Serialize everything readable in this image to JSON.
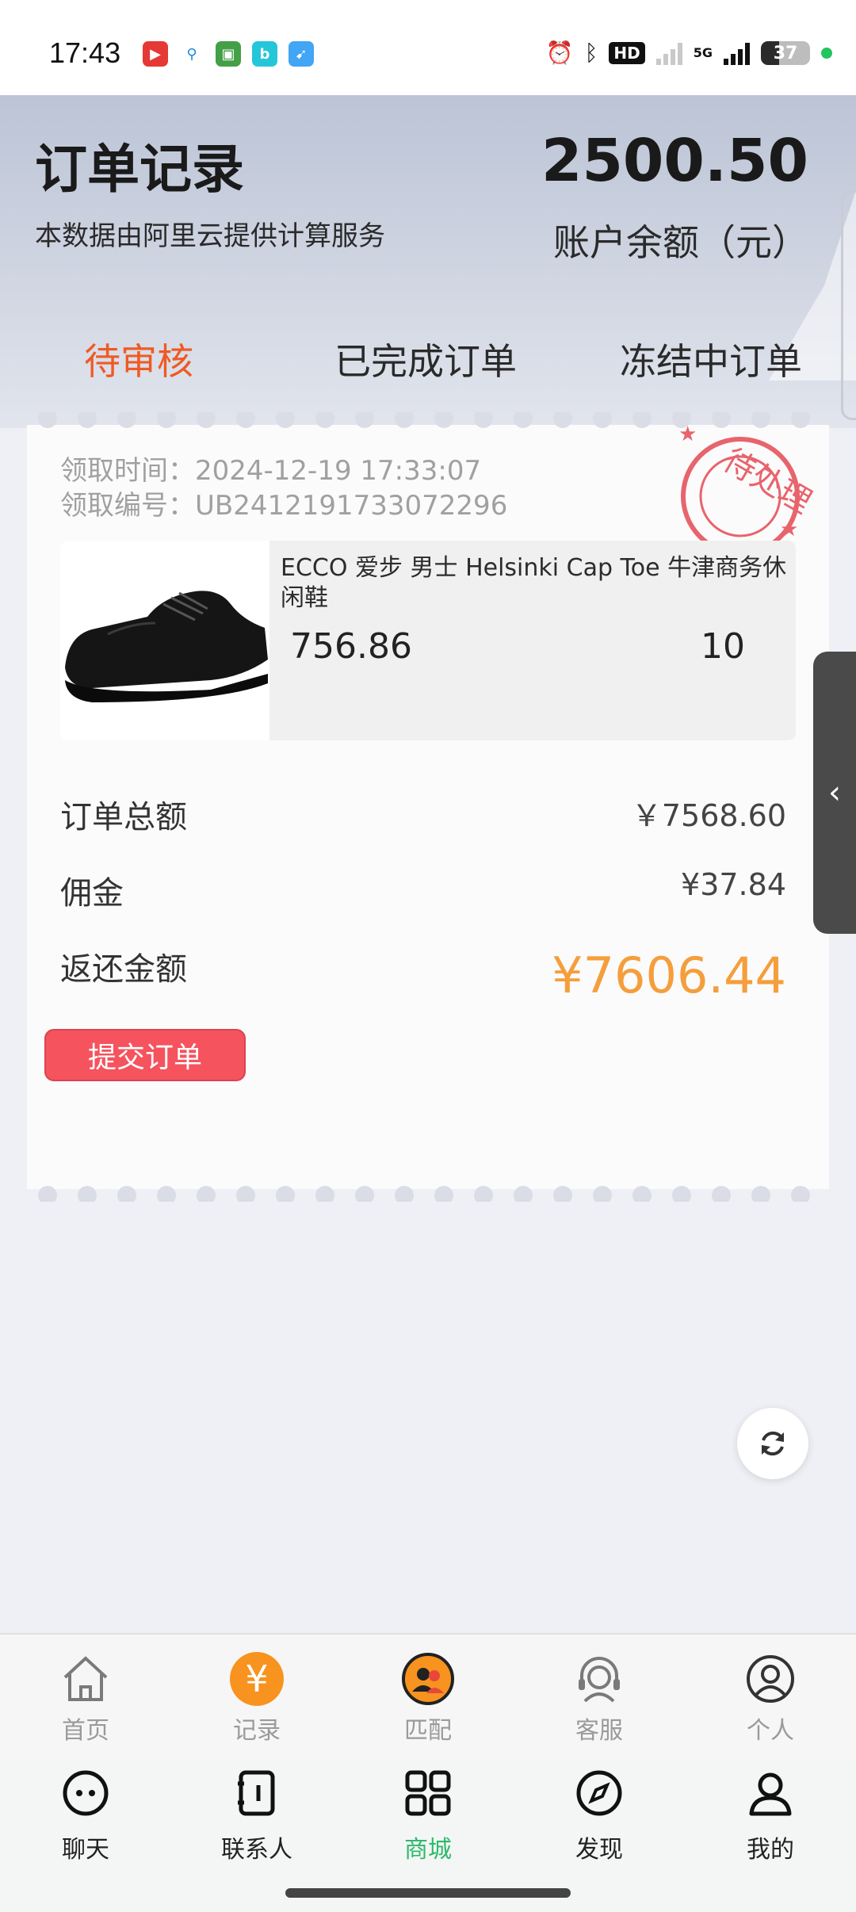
{
  "status_bar": {
    "time": "17:43",
    "hd_label": "HD",
    "network": "5G",
    "battery": "37",
    "battery_level": 0.37
  },
  "header": {
    "title": "订单记录",
    "subtitle": "本数据由阿里云提供计算服务",
    "balance": "2500.50",
    "balance_label": "账户余额（元）"
  },
  "tabs": [
    {
      "label": "待审核",
      "active": true
    },
    {
      "label": "已完成订单",
      "active": false
    },
    {
      "label": "冻结中订单",
      "active": false
    }
  ],
  "order": {
    "time_label": "领取时间：",
    "time_value": "2024-12-19 17:33:07",
    "id_label": "领取编号：",
    "id_value": "UB2412191733072296",
    "stamp_text": "待处理",
    "product_name": "ECCO 爱步 男士 Helsinki Cap Toe 牛津商务休闲鞋",
    "price": "756.86",
    "quantity": "10",
    "total_label": "订单总额",
    "total_value": "￥7568.60",
    "commission_label": "佣金",
    "commission_value": "¥37.84",
    "return_label": "返还金额",
    "return_value": "¥7606.44",
    "submit_label": "提交订单"
  },
  "nav_top": [
    {
      "label": "首页",
      "icon": "home-icon"
    },
    {
      "label": "记录",
      "icon": "yuan-icon"
    },
    {
      "label": "匹配",
      "icon": "match-icon"
    },
    {
      "label": "客服",
      "icon": "headset-icon"
    },
    {
      "label": "个人",
      "icon": "user-circle-icon"
    }
  ],
  "nav_bottom": [
    {
      "label": "聊天",
      "icon": "chat-icon"
    },
    {
      "label": "联系人",
      "icon": "contacts-icon"
    },
    {
      "label": "商城",
      "icon": "grid-icon",
      "active": true
    },
    {
      "label": "发现",
      "icon": "compass-icon"
    },
    {
      "label": "我的",
      "icon": "person-icon"
    }
  ],
  "colors": {
    "accent_orange": "#ef5a24",
    "return_amount": "#f59e3c",
    "submit_button": "#f5535e",
    "stamp": "#e8646c",
    "active_nav": "#2dba6a"
  }
}
